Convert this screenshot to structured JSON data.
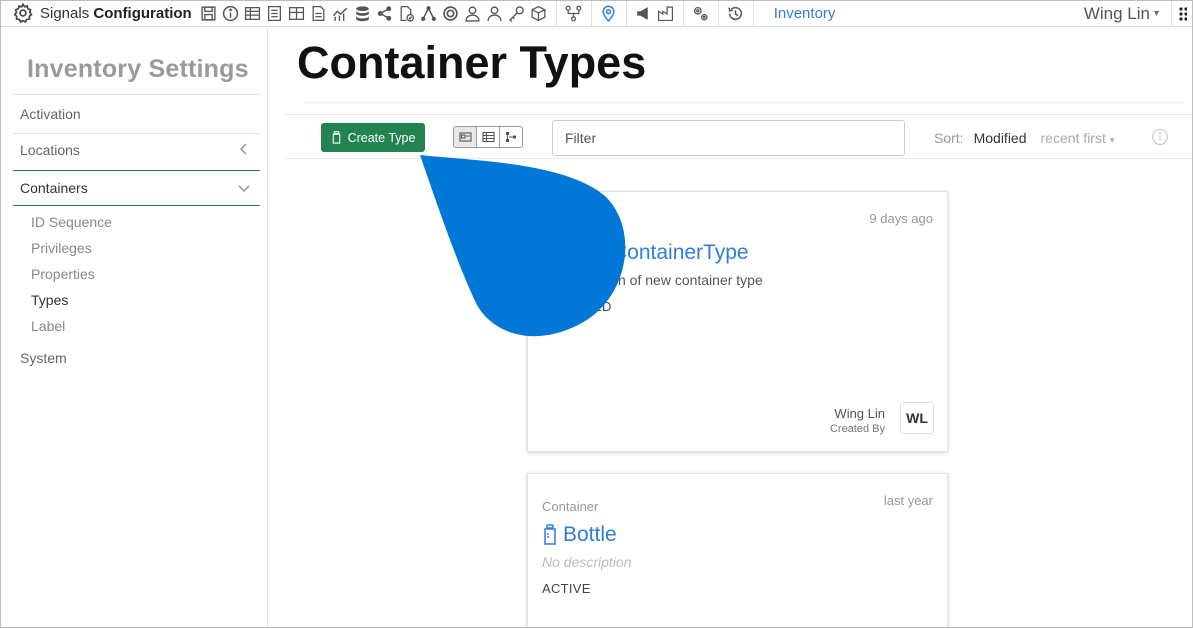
{
  "header": {
    "app_prefix": "Signals",
    "app_name": "Configuration",
    "nav_inventory": "Inventory",
    "user_name": "Wing Lin"
  },
  "sidebar": {
    "title": "Inventory Settings",
    "items": [
      {
        "label": "Activation"
      },
      {
        "label": "Locations"
      },
      {
        "label": "Containers"
      },
      {
        "label": "System"
      }
    ],
    "sub_items": [
      {
        "label": "ID Sequence"
      },
      {
        "label": "Privileges"
      },
      {
        "label": "Properties"
      },
      {
        "label": "Types"
      },
      {
        "label": "Label"
      }
    ]
  },
  "main": {
    "title": "Container Types",
    "create_button": "Create Type",
    "filter_placeholder": "Filter",
    "sort_label": "Sort:",
    "sort_value": "Modified",
    "sort_order": "recent first"
  },
  "cards": [
    {
      "time": "9 days ago",
      "name": "ContainerType",
      "description": "n of new container type",
      "status": "ED",
      "created_by_name": "Wing Lin",
      "created_by_label": "Created By",
      "avatar": "WL"
    },
    {
      "kind": "Container",
      "time": "last year",
      "name": "Bottle",
      "description": "No description",
      "status": "ACTIVE"
    }
  ],
  "colors": {
    "primary_green": "#21834f",
    "link_blue": "#2f7fd6",
    "overlay_blue": "#0177d7"
  }
}
